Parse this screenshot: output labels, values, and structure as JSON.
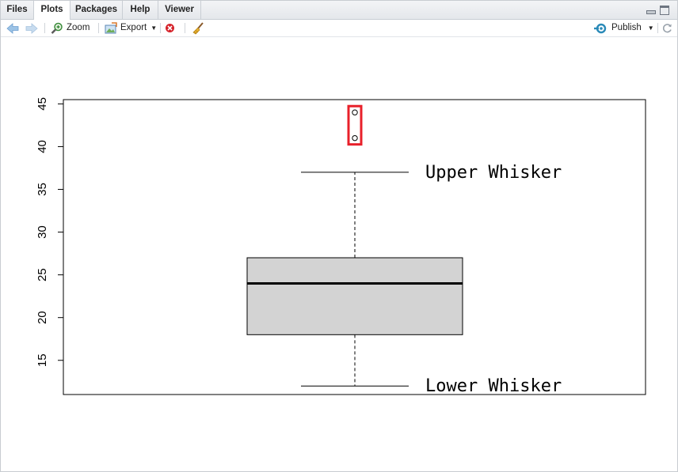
{
  "tabs": [
    "Files",
    "Plots",
    "Packages",
    "Help",
    "Viewer"
  ],
  "active_tab": "Plots",
  "toolbar": {
    "zoom_label": "Zoom",
    "export_label": "Export",
    "publish_label": "Publish"
  },
  "colors": {
    "box_fill": "#d3d3d3",
    "highlight": "#e8202a",
    "accent_blue": "#2a8ab8"
  },
  "chart_data": {
    "type": "box",
    "ylim": [
      11,
      45.5
    ],
    "y_ticks": [
      15,
      20,
      25,
      30,
      35,
      40,
      45
    ],
    "box": {
      "lower_whisker": 12,
      "q1": 18,
      "median": 24,
      "q3": 27,
      "upper_whisker": 37
    },
    "outliers": [
      41,
      44
    ],
    "annotations": {
      "upper": "Upper Whisker",
      "lower": "Lower Whisker"
    },
    "grid": false
  }
}
